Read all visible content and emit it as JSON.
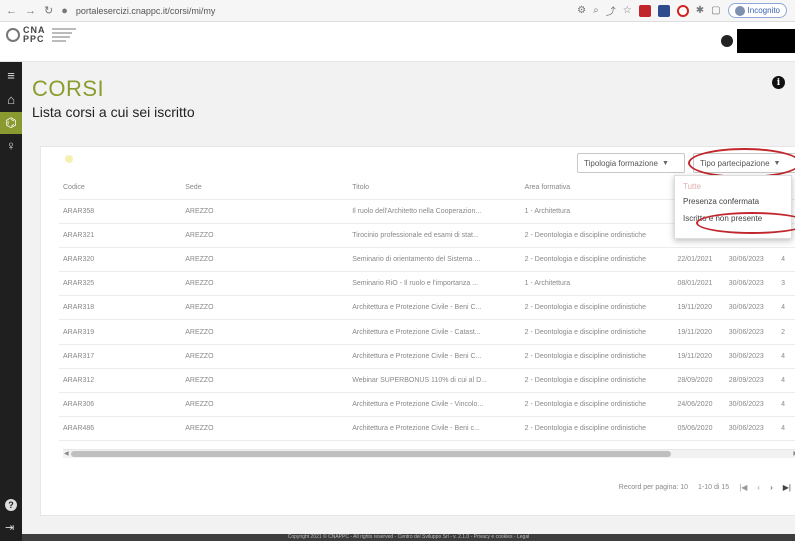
{
  "browser": {
    "url": "portalesercizi.cnappc.it/corsi/mi/my",
    "profile_label": "Incognito"
  },
  "header": {
    "logo_text": "CNA PPC"
  },
  "sidebar": {
    "active_color": "#8a9a30"
  },
  "page": {
    "title": "CORSI",
    "subtitle": "Lista corsi a cui sei iscritto",
    "info_icon": "i"
  },
  "filters": {
    "tipologia": "Tipologia formazione",
    "partecipazione": "Tipo partecipazione"
  },
  "dropdown": {
    "items": [
      "Tutte",
      "Presenza confermata",
      "Iscritto e non presente"
    ]
  },
  "table": {
    "headers": [
      "Codice",
      "Sede",
      "Titolo",
      "Area formativa",
      "",
      "",
      ""
    ],
    "rows": [
      [
        "ARAR358",
        "AREZZO",
        "Il ruolo dell'Architetto nella Cooperazion...",
        "1 - Architettura",
        "",
        "",
        ""
      ],
      [
        "ARAR321",
        "AREZZO",
        "Tirocinio professionale ed esami di stat...",
        "2 - Deontologia e discipline ordinistiche",
        "18/02/2021",
        "30/06/2023",
        "4"
      ],
      [
        "ARAR320",
        "AREZZO",
        "Seminario di orientamento del Sistema ...",
        "2 - Deontologia e discipline ordinistiche",
        "22/01/2021",
        "30/06/2023",
        "4"
      ],
      [
        "ARAR325",
        "AREZZO",
        "Seminario RiO - Il ruolo e l'importanza ...",
        "1 - Architettura",
        "08/01/2021",
        "30/06/2023",
        "3"
      ],
      [
        "ARAR318",
        "AREZZO",
        "Architettura e Protezione Civile - Beni C...",
        "2 - Deontologia e discipline ordinistiche",
        "19/11/2020",
        "30/06/2023",
        "4"
      ],
      [
        "ARAR319",
        "AREZZO",
        "Architettura e Protezione Civile - Catast...",
        "2 - Deontologia e discipline ordinistiche",
        "19/11/2020",
        "30/06/2023",
        "2"
      ],
      [
        "ARAR317",
        "AREZZO",
        "Architettura e Protezione Civile - Beni C...",
        "2 - Deontologia e discipline ordinistiche",
        "19/11/2020",
        "30/06/2023",
        "4"
      ],
      [
        "ARAR312",
        "AREZZO",
        "Webinar SUPERBONUS 110% di cui al D...",
        "2 - Deontologia e discipline ordinistiche",
        "28/09/2020",
        "28/09/2023",
        "4"
      ],
      [
        "ARAR306",
        "AREZZO",
        "Architettura e Protezione Civile - Vincolo...",
        "2 - Deontologia e discipline ordinistiche",
        "24/06/2020",
        "30/06/2023",
        "4"
      ],
      [
        "ARAR486",
        "AREZZO",
        "Architettura e Protezione Civile - Beni c...",
        "2 - Deontologia e discipline ordinistiche",
        "05/06/2020",
        "30/06/2023",
        "4"
      ]
    ]
  },
  "pager": {
    "rows_per_page": "Record per pagina: 10",
    "range": "1-10 di 15"
  },
  "footer": {
    "text": "Copyright 2021 © CNAPPC - All rights reserved - Centro del Sviluppo Srl - v. 2.1.0 - Privacy e cookies - Legal"
  }
}
